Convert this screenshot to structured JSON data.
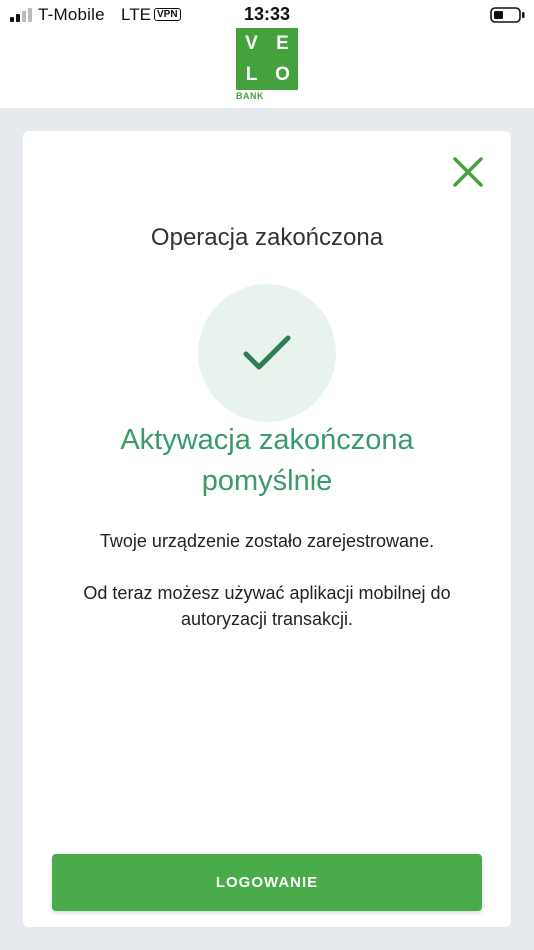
{
  "status_bar": {
    "carrier": "T-Mobile",
    "network": "LTE",
    "vpn": "VPN",
    "time": "13:33"
  },
  "logo": {
    "letters": [
      "V",
      "E",
      "L",
      "O"
    ],
    "bank": "BANK",
    "color": "#45a13d"
  },
  "card": {
    "heading": "Operacja zakończona",
    "success_message": "Aktywacja zakończona pomyślnie",
    "info_registered": "Twoje urządzenie zostało zarejestrowane.",
    "info_usage": "Od teraz możesz używać aplikacji mobilnej do autoryzacji transakcji.",
    "login_button": "LOGOWANIE"
  },
  "icons": {
    "close": "close-icon",
    "check": "check-icon"
  },
  "colors": {
    "accent_green": "#4aab4a",
    "success_text": "#3a9a68",
    "check_bg": "#e8f3ee",
    "page_bg": "#e6e9ee"
  }
}
